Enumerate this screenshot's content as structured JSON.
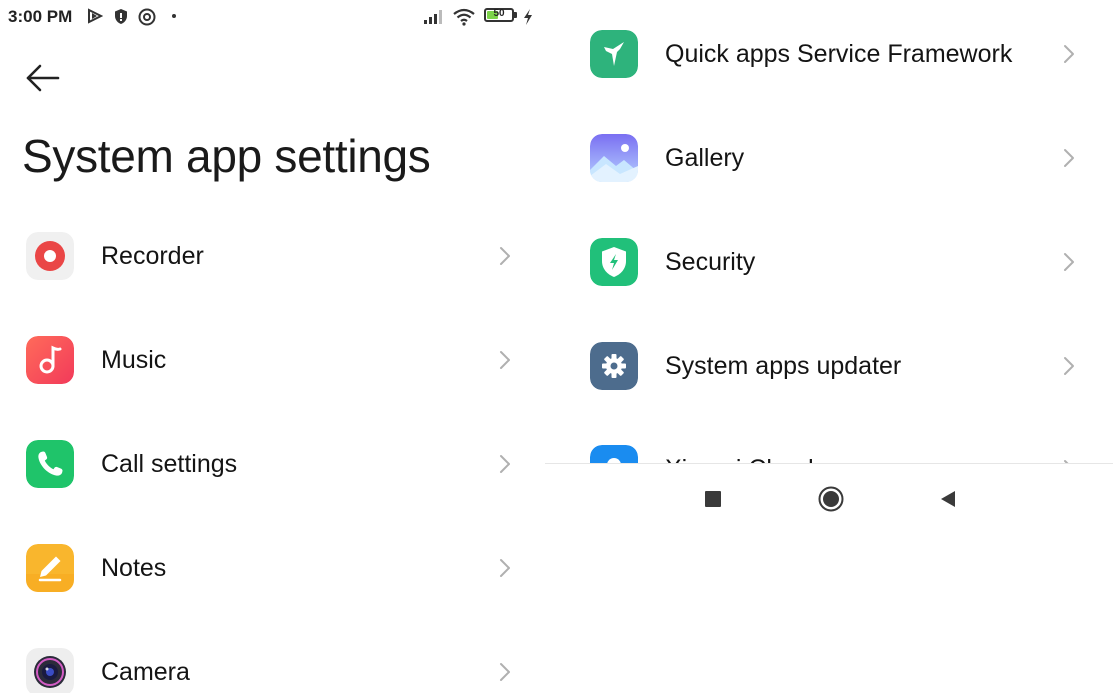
{
  "status_bar": {
    "time": "3:00 PM",
    "battery_level": "50",
    "icons": [
      "play-protect-icon",
      "shield-icon",
      "at-icon",
      "dot-icon",
      "signal-icon",
      "wifi-icon",
      "battery-icon",
      "charging-icon"
    ]
  },
  "page": {
    "title": "System app settings"
  },
  "left_list": [
    {
      "label": "Recorder",
      "icon": "recorder-icon",
      "color": "#e84545"
    },
    {
      "label": "Music",
      "icon": "music-icon",
      "color": "#f5484f"
    },
    {
      "label": "Call settings",
      "icon": "phone-icon",
      "color": "#22c36a"
    },
    {
      "label": "Notes",
      "icon": "notes-icon",
      "color": "#f8b52c"
    },
    {
      "label": "Camera",
      "icon": "camera-icon",
      "color": "#3d3d6b"
    }
  ],
  "right_list": [
    {
      "label": "Quick apps Service Framework",
      "icon": "hummingbird-icon",
      "color": "#2fb27b"
    },
    {
      "label": "Gallery",
      "icon": "gallery-icon",
      "color": "#8f8bf0"
    },
    {
      "label": "Security",
      "icon": "security-shield-icon",
      "color": "#27c07a"
    },
    {
      "label": "System apps updater",
      "icon": "gear-icon",
      "color": "#4e6e8f"
    },
    {
      "label": "Xiaomi Cloud",
      "icon": "cloud-icon",
      "color": "#1a8cf0"
    }
  ],
  "nav_bar": {
    "buttons": [
      "recents-button",
      "home-button",
      "back-button"
    ]
  }
}
